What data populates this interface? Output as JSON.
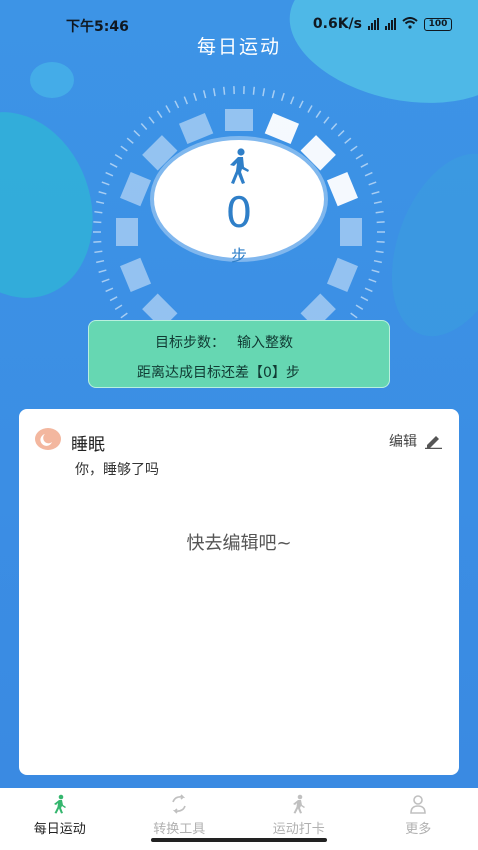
{
  "status": {
    "time": "下午5:46",
    "net": "0.6K/s",
    "battery": "100"
  },
  "header": {
    "title": "每日运动"
  },
  "counter": {
    "steps": "0",
    "unit": "步",
    "walker_icon": "walk-icon",
    "accent": "#2f7fc8"
  },
  "goal": {
    "label": "目标步数：",
    "input_placeholder": "输入整数",
    "remaining": "距离达成目标还差【0】步",
    "color": "#66d7b2"
  },
  "sleep_card": {
    "title": "睡眠",
    "edit_label": "编辑",
    "subtitle": "你，睡够了吗",
    "empty_text": "快去编辑吧~",
    "icon": "moon-icon"
  },
  "tabs": [
    {
      "label": "每日运动",
      "icon": "walk-icon",
      "active": true
    },
    {
      "label": "转换工具",
      "icon": "convert-icon",
      "active": false
    },
    {
      "label": "运动打卡",
      "icon": "checkin-icon",
      "active": false
    },
    {
      "label": "更多",
      "icon": "user-icon",
      "active": false
    }
  ]
}
